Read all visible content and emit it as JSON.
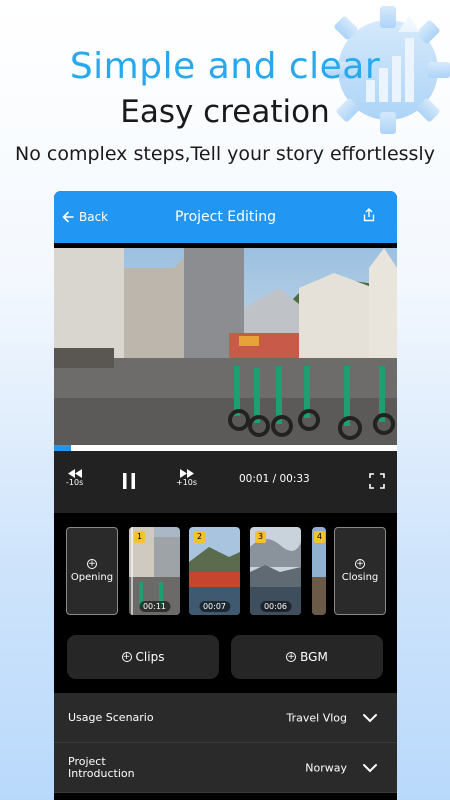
{
  "promo": {
    "headline": "Simple and clear",
    "subhead": "Easy creation",
    "tagline": "No complex steps,Tell your story effortlessly"
  },
  "nav": {
    "back_label": "Back",
    "title": "Project Editing"
  },
  "player": {
    "progress_fraction": 0.05,
    "rewind_label": "-10s",
    "forward_label": "+10s",
    "time": "00:01 / 00:33"
  },
  "clips": {
    "opening_label": "Opening",
    "closing_label": "Closing",
    "items": [
      {
        "index": "1",
        "duration": "00:11"
      },
      {
        "index": "2",
        "duration": "00:07"
      },
      {
        "index": "3",
        "duration": "00:06"
      },
      {
        "index": "4",
        "duration": ""
      }
    ]
  },
  "actions": {
    "clips_label": "Clips",
    "bgm_label": "BGM"
  },
  "settings": {
    "usage_label": "Usage Scenario",
    "usage_value": "Travel Vlog",
    "intro_label": "Project\nIntroduction",
    "intro_value": "Norway"
  },
  "colors": {
    "accent": "#2196f3",
    "headline": "#29a8ee",
    "badge": "#f6c229"
  }
}
